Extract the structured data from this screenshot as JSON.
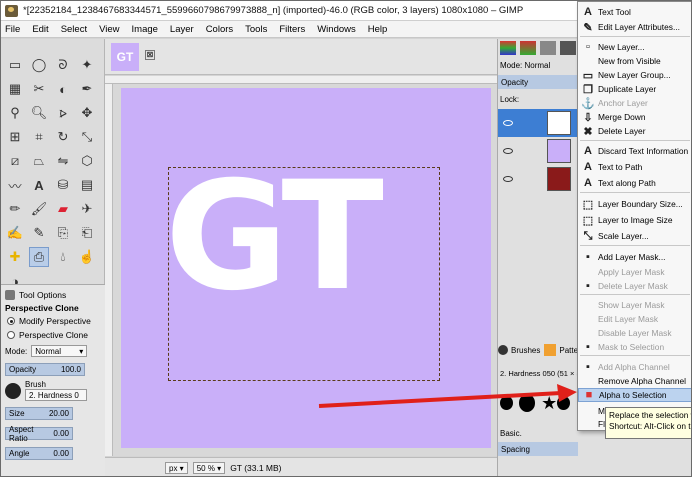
{
  "window": {
    "title": "*[22352184_1238467683344571_5599660798679973888_n] (imported)-46.0 (RGB color, 3 layers) 1080x1080 – GIMP"
  },
  "menubar": [
    "File",
    "Edit",
    "Select",
    "View",
    "Image",
    "Layer",
    "Colors",
    "Tools",
    "Filters",
    "Windows",
    "Help"
  ],
  "image_tab": {
    "thumb_text": "GT",
    "close": "⊠"
  },
  "canvas": {
    "text": "GT",
    "background": "#c9aff9",
    "text_color": "#ffffff"
  },
  "tool_options": {
    "tab_label": "Tool Options",
    "title": "Perspective Clone",
    "radio1": "Modify Perspective",
    "radio2": "Perspective Clone",
    "mode_label": "Mode:",
    "mode_value": "Normal",
    "opacity_label": "Opacity",
    "opacity_value": "100.0",
    "brush_label": "Brush",
    "brush_value": "2. Hardness 0",
    "size_label": "Size",
    "size_value": "20.00",
    "aspect_label": "Aspect Ratio",
    "aspect_value": "0.00",
    "angle_label": "Angle",
    "angle_value": "0.00"
  },
  "status": {
    "unit": "px",
    "zoom": "50 %",
    "info": "GT (33.1 MB)"
  },
  "layers": {
    "mode_label": "Mode:",
    "mode_value": "Normal",
    "opacity_label": "Opacity",
    "lock_label": "Lock:"
  },
  "brushes": {
    "tab1": "Brushes",
    "tab2": "Pattern",
    "hardness": "2. Hardness 050 (51 × 51)",
    "basic": "Basic.",
    "spacing_label": "Spacing"
  },
  "context_menu": [
    {
      "label": "Text Tool",
      "icon": "A",
      "disabled": false
    },
    {
      "label": "Edit Layer Attributes...",
      "icon": "✎",
      "disabled": false
    },
    {
      "label": "New Layer...",
      "icon": "▫",
      "disabled": false
    },
    {
      "label": "New from Visible",
      "icon": "",
      "disabled": false
    },
    {
      "label": "New Layer Group...",
      "icon": "▭",
      "disabled": false
    },
    {
      "label": "Duplicate Layer",
      "icon": "❐",
      "disabled": false
    },
    {
      "label": "Anchor Layer",
      "icon": "⚓",
      "disabled": true
    },
    {
      "label": "Merge Down",
      "icon": "⇩",
      "disabled": false
    },
    {
      "label": "Delete Layer",
      "icon": "✖",
      "disabled": false
    },
    {
      "label": "Discard Text Information",
      "icon": "A",
      "disabled": false
    },
    {
      "label": "Text to Path",
      "icon": "A",
      "disabled": false
    },
    {
      "label": "Text along Path",
      "icon": "A",
      "disabled": false
    },
    {
      "label": "Layer Boundary Size...",
      "icon": "⬚",
      "disabled": false
    },
    {
      "label": "Layer to Image Size",
      "icon": "⬚",
      "disabled": false
    },
    {
      "label": "Scale Layer...",
      "icon": "⤡",
      "disabled": false
    },
    {
      "label": "Add Layer Mask...",
      "icon": "▪",
      "disabled": false
    },
    {
      "label": "Apply Layer Mask",
      "icon": "",
      "disabled": true
    },
    {
      "label": "Delete Layer Mask",
      "icon": "▪",
      "disabled": true
    },
    {
      "label": "Show Layer Mask",
      "icon": "",
      "disabled": true
    },
    {
      "label": "Edit Layer Mask",
      "icon": "",
      "disabled": true
    },
    {
      "label": "Disable Layer Mask",
      "icon": "",
      "disabled": true
    },
    {
      "label": "Mask to Selection",
      "icon": "▪",
      "disabled": true
    },
    {
      "label": "Add Alpha Channel",
      "icon": "▪",
      "disabled": true
    },
    {
      "label": "Remove Alpha Channel",
      "icon": "",
      "disabled": false
    },
    {
      "label": "Alpha to Selection",
      "icon": "■",
      "disabled": false,
      "highlighted": true
    },
    {
      "label": "Me",
      "icon": "",
      "disabled": false
    },
    {
      "label": "Fla",
      "icon": "",
      "disabled": false
    }
  ],
  "tooltip": {
    "line1": "Replace the selection wi",
    "line2": "Shortcut: Alt-Click on th"
  },
  "colors": {
    "arrow": "#e0201a",
    "highlight": "#bcd3ef",
    "canvas_bg": "#c9aff9"
  }
}
